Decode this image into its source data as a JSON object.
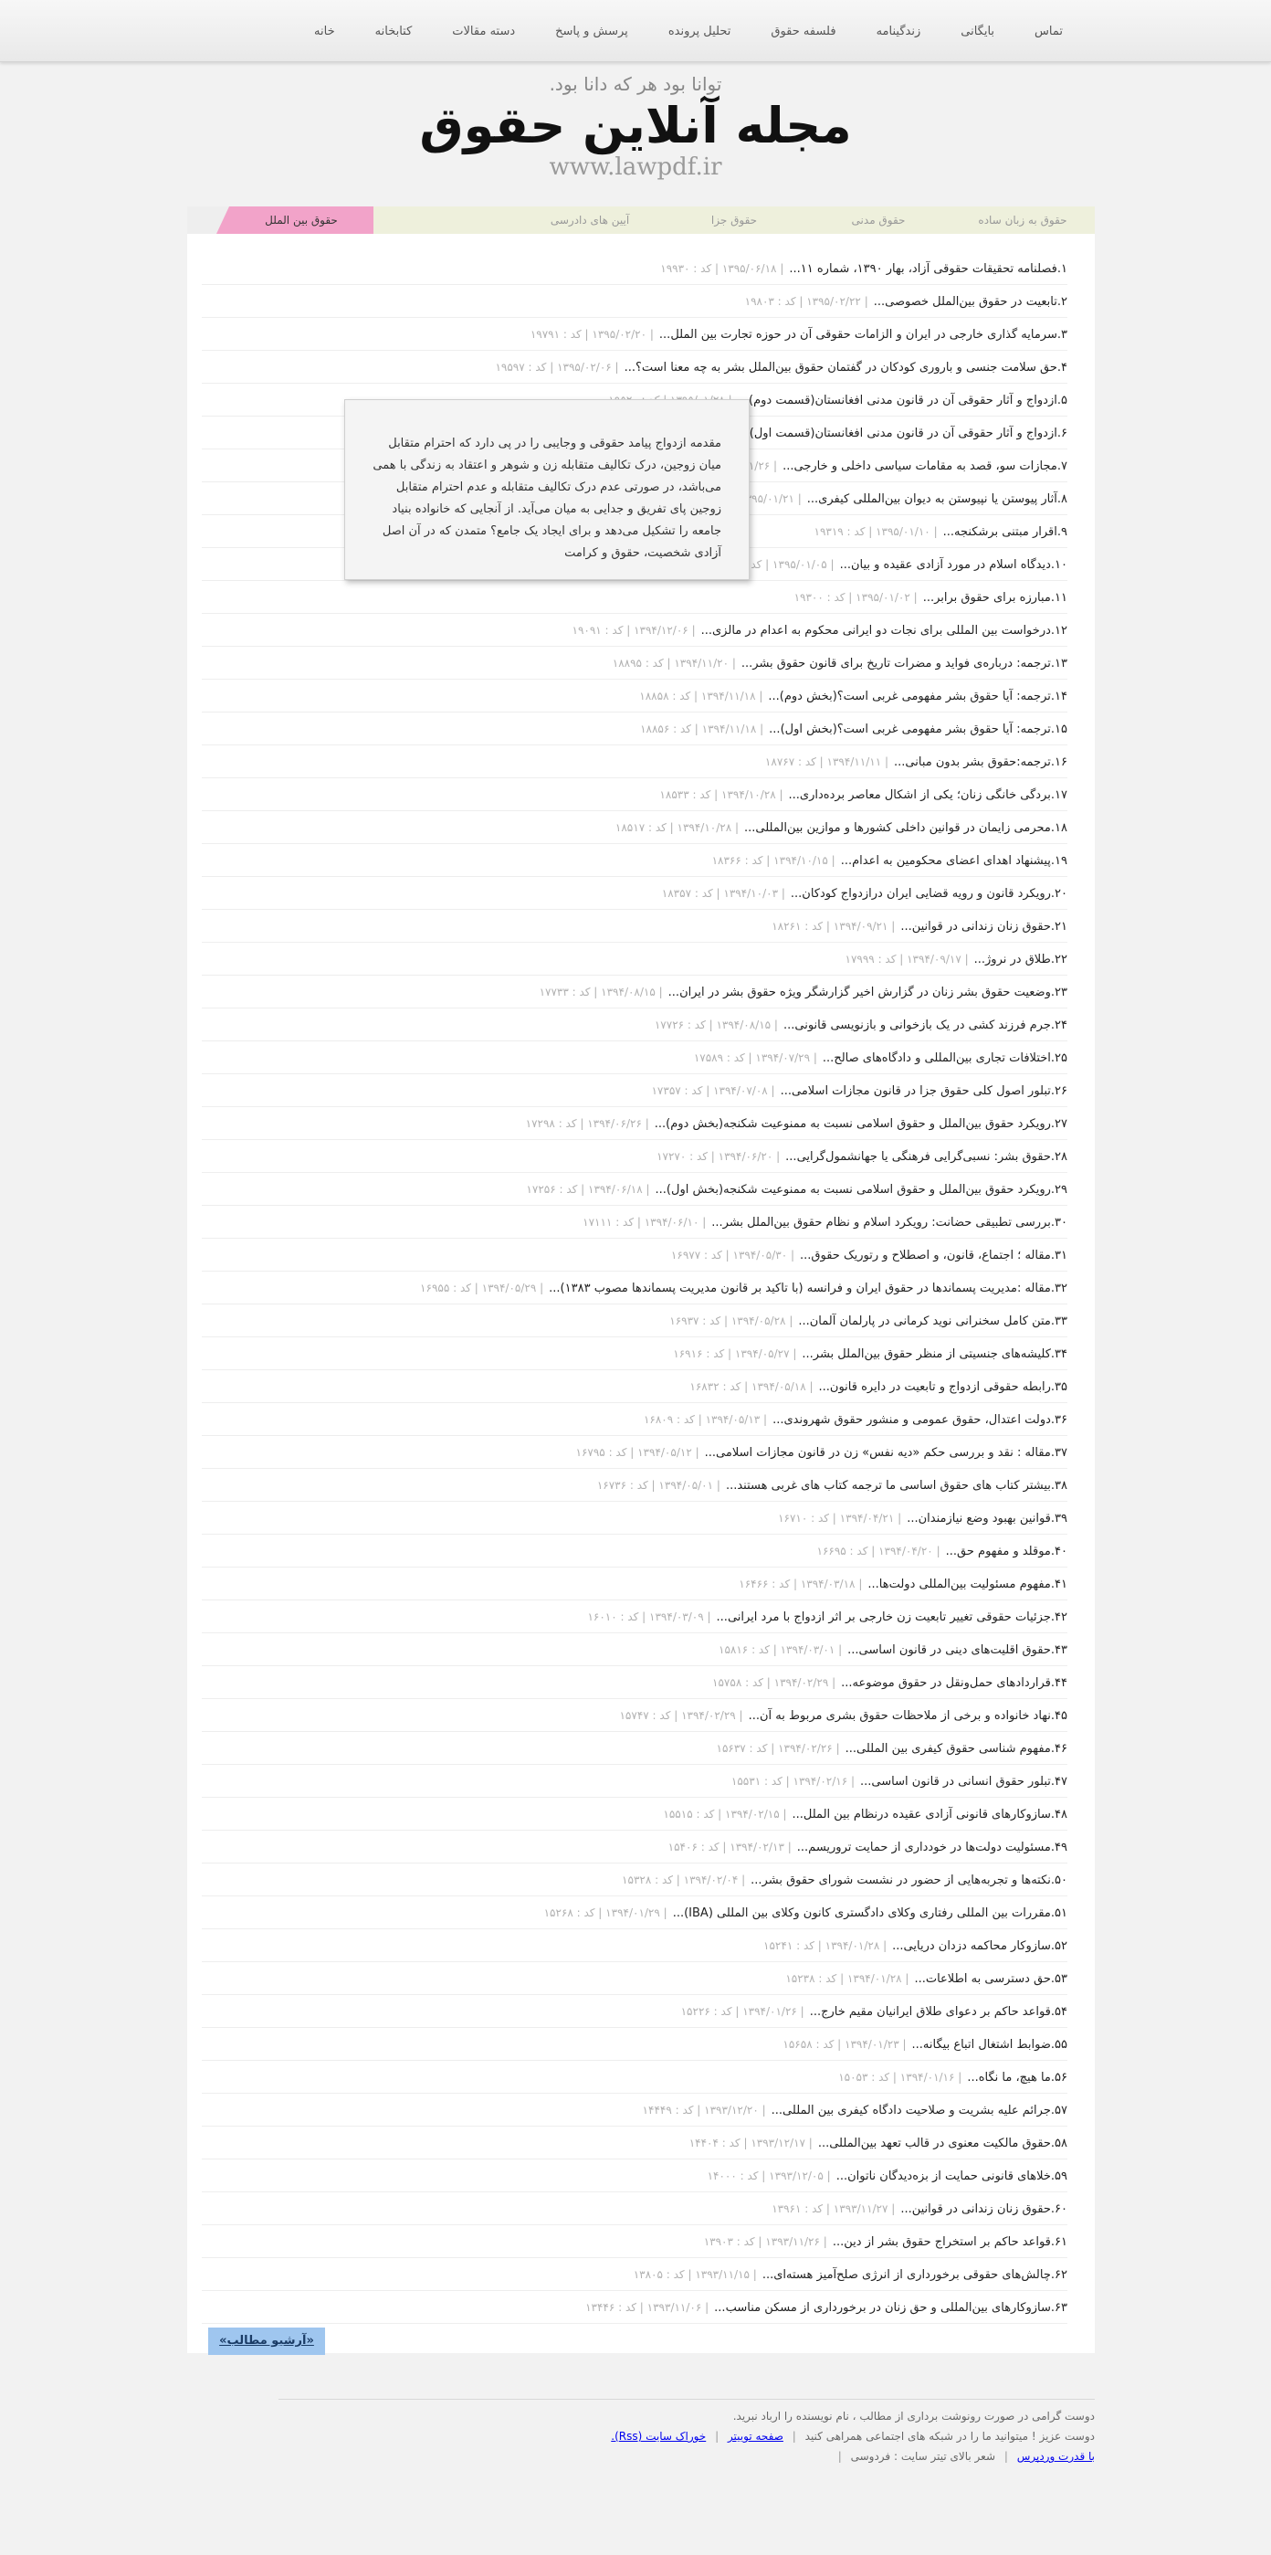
{
  "nav": [
    "خانه",
    "کتابخانه",
    "دسته مقالات",
    "پرسش و پاسخ",
    "تحلیل پرونده",
    "فلسفه حقوق",
    "زندگینامه",
    "بایگانی",
    "تماس"
  ],
  "header": {
    "motto": "توانا بود هر که دانا بود.",
    "title": "مجله آنلاین حقوق",
    "url": "www.lawpdf.ir"
  },
  "tabs": [
    {
      "label": "حقوق به زبان ساده",
      "active": false
    },
    {
      "label": "حقوق مدنی",
      "active": false
    },
    {
      "label": "حقوق جزا",
      "active": false
    },
    {
      "label": "آیین های دادرسی",
      "active": false
    },
    {
      "label": "",
      "active": false
    },
    {
      "label": "حقوق بین الملل",
      "active": true
    }
  ],
  "tooltip": "مقدمه ازدواج پیامد حقوقی و وجایبی را در پی دارد که احترام متقابل میان زوجین، درک تکالیف متقابله زن و شوهر و اعتقاد به زندگی با همی می‌باشد، در صورتی عدم درک تکالیف متقابله و عدم احترام متقابل زوجین پای تفریق و جدایی به میان می‌آید. از آنجایی که خانواده بنیاد جامعه را تشکیل می‌دهد و برای ایجاد یک جامع؟ متمدن که در آن اصل آزادی شخصیت، حقوق و کرامت",
  "posts": [
    {
      "n": "۱",
      "title": "فصلنامه تحقیقات حقوقی آزاد، بهار ۱۳۹۰، شماره ۱۱...",
      "meta": "| ۱۳۹۵/۰۶/۱۸ | کد : ۱۹۹۳۰"
    },
    {
      "n": "۲",
      "title": "تابعیت در حقوق بین‌الملل خصوصی...",
      "meta": "| ۱۳۹۵/۰۲/۲۲ | کد : ۱۹۸۰۳"
    },
    {
      "n": "۳",
      "title": "سرمایه گذاری خارجی در ایران و الزامات حقوقی آن در حوزه تجارت بین الملل...",
      "meta": "| ۱۳۹۵/۰۲/۲۰ | کد : ۱۹۷۹۱"
    },
    {
      "n": "۴",
      "title": "حق سلامت جنسی و باروری کودکان در گفتمان حقوق بین‌الملل بشر به چه معنا است؟...",
      "meta": "| ۱۳۹۵/۰۲/۰۶ | کد : ۱۹۵۹۷"
    },
    {
      "n": "۵",
      "title": "ازدواج و آثار حقوقی آن در قانون مدنی افغانستان(قسمت دوم)...",
      "meta": "| ۱۳۹۵/۰۱/۲۸ | کد : ۱۹۵۲۰"
    },
    {
      "n": "۶",
      "title": "ازدواج و آثار حقوقی آن در قانون مدنی افغانستان(قسمت اول)...",
      "meta": "| ۱۳۹۵/۰۱/۲۸ | کد : ۱۹۵۱۹"
    },
    {
      "n": "۷",
      "title": "مجازات سو، قصد به مقامات سیاسی داخلی و خارجی...",
      "meta": "| ۱۳۹۵/۰۱/۲۶ | کد : ۱۹۴۸۶"
    },
    {
      "n": "۸",
      "title": "آثار پیوستن یا نپیوستن به دیوان بین‌المللی کیفری...",
      "meta": "| ۱۳۹۵/۰۱/۲۱ | کد : ۱۹۴۵۱"
    },
    {
      "n": "۹",
      "title": "اقرار مبتنی برشکنجه...",
      "meta": "| ۱۳۹۵/۰۱/۱۰ | کد : ۱۹۳۱۹"
    },
    {
      "n": "۱۰",
      "title": "دیدگاه اسلام در مورد آزادی عقیده و بیان...",
      "meta": "| ۱۳۹۵/۰۱/۰۵ | کد : ۱۹۳۰۵"
    },
    {
      "n": "۱۱",
      "title": "مبارزه برای حقوق برابر...",
      "meta": "| ۱۳۹۵/۰۱/۰۲ | کد : ۱۹۳۰۰"
    },
    {
      "n": "۱۲",
      "title": "درخواست بین المللی برای نجات دو ایرانی محکوم به اعدام در مالزی...",
      "meta": "| ۱۳۹۴/۱۲/۰۶ | کد : ۱۹۰۹۱"
    },
    {
      "n": "۱۳",
      "title": "ترجمه: درباره‌ی فواید و مضرات تاریخ برای قانون حقوق بشر...",
      "meta": "| ۱۳۹۴/۱۱/۲۰ | کد : ۱۸۸۹۵"
    },
    {
      "n": "۱۴",
      "title": "ترجمه: آیا حقوق بشر مفهومی غربی است؟(بخش دوم)...",
      "meta": "| ۱۳۹۴/۱۱/۱۸ | کد : ۱۸۸۵۸"
    },
    {
      "n": "۱۵",
      "title": "ترجمه: آیا حقوق بشر مفهومی غربی است؟(بخش اول)...",
      "meta": "| ۱۳۹۴/۱۱/۱۸ | کد : ۱۸۸۵۶"
    },
    {
      "n": "۱۶",
      "title": "ترجمه:حقوق بشر بدون مبانی...",
      "meta": "| ۱۳۹۴/۱۱/۱۱ | کد : ۱۸۷۶۷"
    },
    {
      "n": "۱۷",
      "title": "بردگی خانگی زنان؛ یکی از اشکال معاصر برده‌داری...",
      "meta": "| ۱۳۹۴/۱۰/۲۸ | کد : ۱۸۵۳۳"
    },
    {
      "n": "۱۸",
      "title": "محرمی زایمان در قوانین داخلی کشورها و موازین بین‌المللی...",
      "meta": "| ۱۳۹۴/۱۰/۲۸ | کد : ۱۸۵۱۷"
    },
    {
      "n": "۱۹",
      "title": "پیشنهاد اهدای اعضای محکومین به اعدام...",
      "meta": "| ۱۳۹۴/۱۰/۱۵ | کد : ۱۸۳۶۶"
    },
    {
      "n": "۲۰",
      "title": "رویکرد قانون و رویه قضایی ایران درازدواج کودکان...",
      "meta": "| ۱۳۹۴/۱۰/۰۳ | کد : ۱۸۳۵۷"
    },
    {
      "n": "۲۱",
      "title": "حقوق زنان زندانی در قوانین...",
      "meta": "| ۱۳۹۴/۰۹/۲۱ | کد : ۱۸۲۶۱"
    },
    {
      "n": "۲۲",
      "title": "طلاق در نروژ...",
      "meta": "| ۱۳۹۴/۰۹/۱۷ | کد : ۱۷۹۹۹"
    },
    {
      "n": "۲۳",
      "title": "وضعیت حقوق بشر زنان در گزارش اخیر گزارشگر ویژه حقوق بشر در ایران...",
      "meta": "| ۱۳۹۴/۰۸/۱۵ | کد : ۱۷۷۳۳"
    },
    {
      "n": "۲۴",
      "title": "جرم فرزند کشی در یک بازخوانی و بازنویسی قانونی...",
      "meta": "| ۱۳۹۴/۰۸/۱۵ | کد : ۱۷۷۲۶"
    },
    {
      "n": "۲۵",
      "title": "اختلافات تجاری بین‌المللی و دادگاه‌های صالح...",
      "meta": "| ۱۳۹۴/۰۷/۲۹ | کد : ۱۷۵۸۹"
    },
    {
      "n": "۲۶",
      "title": "تبلور اصول کلی حقوق جزا در قانون مجازات اسلامی...",
      "meta": "| ۱۳۹۴/۰۷/۰۸ | کد : ۱۷۳۵۷"
    },
    {
      "n": "۲۷",
      "title": "رویکرد حقوق بین‌الملل و حقوق اسلامی نسبت به ممنوعیت شکنجه(بخش دوم)...",
      "meta": "| ۱۳۹۴/۰۶/۲۶ | کد : ۱۷۲۹۸"
    },
    {
      "n": "۲۸",
      "title": "حقوق بشر: نسبی‌گرایی فرهنگی یا جهانشمول‌گرایی...",
      "meta": "| ۱۳۹۴/۰۶/۲۰ | کد : ۱۷۲۷۰"
    },
    {
      "n": "۲۹",
      "title": "رویکرد حقوق بین‌الملل و حقوق اسلامی نسبت به ممنوعیت شکنجه(بخش اول)...",
      "meta": "| ۱۳۹۴/۰۶/۱۸ | کد : ۱۷۲۵۶"
    },
    {
      "n": "۳۰",
      "title": "بررسی تطبیقی حضانت: رویکرد اسلام و نظام حقوق بین‌الملل بشر...",
      "meta": "| ۱۳۹۴/۰۶/۱۰ | کد : ۱۷۱۱۱"
    },
    {
      "n": "۳۱",
      "title": "مقاله ؛ اجتماع، قانون، و اصطلاح و رتوریک حقوق...",
      "meta": "| ۱۳۹۴/۰۵/۳۰ | کد : ۱۶۹۷۷"
    },
    {
      "n": "۳۲",
      "title": "مقاله :مدیریت پسماندها در حقوق ایران و فرانسه (با تاکید بر قانون مدیریت پسماندها مصوب ۱۳۸۳)...",
      "meta": "| ۱۳۹۴/۰۵/۲۹ | کد : ۱۶۹۵۵"
    },
    {
      "n": "۳۳",
      "title": "متن کامل سخنرانی نوید کرمانی در پارلمان آلمان...",
      "meta": "| ۱۳۹۴/۰۵/۲۸ | کد : ۱۶۹۳۷"
    },
    {
      "n": "۳۴",
      "title": "کلیشه‌های جنسیتی از منظر حقوق بین‌الملل بشر...",
      "meta": "| ۱۳۹۴/۰۵/۲۷ | کد : ۱۶۹۱۶"
    },
    {
      "n": "۳۵",
      "title": "رابطه حقوقی ازدواج و تابعیت در دایره قانون...",
      "meta": "| ۱۳۹۴/۰۵/۱۸ | کد : ۱۶۸۳۲"
    },
    {
      "n": "۳۶",
      "title": "دولت اعتدال، حقوق عمومی و منشور حقوق شهروندی...",
      "meta": "| ۱۳۹۴/۰۵/۱۳ | کد : ۱۶۸۰۹"
    },
    {
      "n": "۳۷",
      "title": "مقاله : نقد و بررسی حکم «دیه نفس» زن در قانون مجازات اسلامی...",
      "meta": "| ۱۳۹۴/۰۵/۱۲ | کد : ۱۶۷۹۵"
    },
    {
      "n": "۳۸",
      "title": "بیشتر کتاب های حقوق اساسی ما ترجمه کتاب های غربی هستند...",
      "meta": "| ۱۳۹۴/۰۵/۰۱ | کد : ۱۶۷۳۶"
    },
    {
      "n": "۳۹",
      "title": "قوانین بهبود وضع نیازمندان...",
      "meta": "| ۱۳۹۴/۰۴/۲۱ | کد : ۱۶۷۱۰"
    },
    {
      "n": "۴۰",
      "title": "موقلد و مفهوم حق...",
      "meta": "| ۱۳۹۴/۰۴/۲۰ | کد : ۱۶۶۹۵"
    },
    {
      "n": "۴۱",
      "title": "مفهوم مسئولیت بین‌المللی دولت‌ها...",
      "meta": "| ۱۳۹۴/۰۳/۱۸ | کد : ۱۶۴۶۶"
    },
    {
      "n": "۴۲",
      "title": "جزئیات حقوقی تغییر تابعیت زن خارجی بر اثر ازدواج با مرد ایرانی...",
      "meta": "| ۱۳۹۴/۰۳/۰۹ | کد : ۱۶۰۱۰"
    },
    {
      "n": "۴۳",
      "title": "حقوق اقلیت‌های دینی در قانون اساسی...",
      "meta": "| ۱۳۹۴/۰۳/۰۱ | کد : ۱۵۸۱۶"
    },
    {
      "n": "۴۴",
      "title": "قراردادهای حمل‌ونقل در حقوق موضوعه...",
      "meta": "| ۱۳۹۴/۰۲/۲۹ | کد : ۱۵۷۵۸"
    },
    {
      "n": "۴۵",
      "title": "نهاد خانواده و برخی از ملاحظات حقوق بشری مربوط به آن...",
      "meta": "| ۱۳۹۴/۰۲/۲۹ | کد : ۱۵۷۴۷"
    },
    {
      "n": "۴۶",
      "title": "مفهوم شناسی حقوق کیفری بین المللی...",
      "meta": "| ۱۳۹۴/۰۲/۲۶ | کد : ۱۵۶۳۷"
    },
    {
      "n": "۴۷",
      "title": "تبلور حقوق انسانی در قانون اساسی...",
      "meta": "| ۱۳۹۴/۰۲/۱۶ | کد : ۱۵۵۳۱"
    },
    {
      "n": "۴۸",
      "title": "سازوکارهای قانونی آزادی عقیده درنظام بین الملل...",
      "meta": "| ۱۳۹۴/۰۲/۱۵ | کد : ۱۵۵۱۵"
    },
    {
      "n": "۴۹",
      "title": "مسئولیت دولت‌ها در خودداری از حمایت تروریسم...",
      "meta": "| ۱۳۹۴/۰۲/۱۳ | کد : ۱۵۴۰۶"
    },
    {
      "n": "۵۰",
      "title": "نکته‌ها و تجربه‌هایی از حضور در نشست شورای حقوق بشر...",
      "meta": "| ۱۳۹۴/۰۲/۰۴ | کد : ۱۵۳۲۸"
    },
    {
      "n": "۵۱",
      "title": "مقررات بین المللی رفتاری وکلای دادگستری کانون وکلای بین المللی (IBA)...",
      "meta": "| ۱۳۹۴/۰۱/۲۹ | کد : ۱۵۲۶۸"
    },
    {
      "n": "۵۲",
      "title": "سازوکار محاکمه دزدان دریایی...",
      "meta": "| ۱۳۹۴/۰۱/۲۸ | کد : ۱۵۲۴۱"
    },
    {
      "n": "۵۳",
      "title": "حق دسترسی به اطلاعات...",
      "meta": "| ۱۳۹۴/۰۱/۲۸ | کد : ۱۵۲۳۸"
    },
    {
      "n": "۵۴",
      "title": "قواعد حاکم بر دعوای طلاق ایرانیان مقیم خارج...",
      "meta": "| ۱۳۹۴/۰۱/۲۶ | کد : ۱۵۲۲۶"
    },
    {
      "n": "۵۵",
      "title": "ضوابط اشتغال اتباع بیگانه...",
      "meta": "| ۱۳۹۴/۰۱/۲۳ | کد : ۱۵۶۵۸"
    },
    {
      "n": "۵۶",
      "title": "ما هیچ، ما نگاه...",
      "meta": "| ۱۳۹۴/۰۱/۱۶ | کد : ۱۵۰۵۳"
    },
    {
      "n": "۵۷",
      "title": "جرائم علیه بشریت و صلاحیت دادگاه کیفری بین المللی...",
      "meta": "| ۱۳۹۳/۱۲/۲۰ | کد : ۱۴۴۴۹"
    },
    {
      "n": "۵۸",
      "title": "حقوق مالکیت معنوی در قالب تعهد بین‌المللی...",
      "meta": "| ۱۳۹۳/۱۲/۱۷ | کد : ۱۴۴۰۴"
    },
    {
      "n": "۵۹",
      "title": "خلاهای قانونی حمایت از بزه‌دیدگان ناتوان...",
      "meta": "| ۱۳۹۳/۱۲/۰۵ | کد : ۱۴۰۰۰"
    },
    {
      "n": "۶۰",
      "title": "حقوق زنان زندانی در قوانین...",
      "meta": "| ۱۳۹۳/۱۱/۲۷ | کد : ۱۳۹۶۱"
    },
    {
      "n": "۶۱",
      "title": "قواعد حاکم بر استخراج حقوق بشر از دین...",
      "meta": "| ۱۳۹۳/۱۱/۲۶ | کد : ۱۳۹۰۳"
    },
    {
      "n": "۶۲",
      "title": "چالش‌های حقوقی برخورداری از انرژی صلح‌آمیز هسته‌ای...",
      "meta": "| ۱۳۹۳/۱۱/۱۵ | کد : ۱۳۸۰۵"
    },
    {
      "n": "۶۳",
      "title": "سازوکارهای بین‌المللی و حق زنان در برخورداری از مسکن مناسب...",
      "meta": "| ۱۳۹۳/۱۱/۰۶ | کد : ۱۳۴۴۶"
    }
  ],
  "archive_label": "«آرشیو مطالب»",
  "footer": {
    "line1": "دوست گرامی در صورت رونوشت برداری از مطالب ، نام نویسنده را ارباد نبرید.",
    "line2_a": "دوست عزیز ! میتوانید ما را در شبکه های اجتماعی همراهی کنید",
    "line2_b": "صفحه توییتر",
    "line2_c": "خوراک سایت (Rss).",
    "line3_a": "با قدرت وردپرس",
    "line3_b": "شعر بالای تیتر سایت : فردوسی",
    "line3_c": ""
  }
}
